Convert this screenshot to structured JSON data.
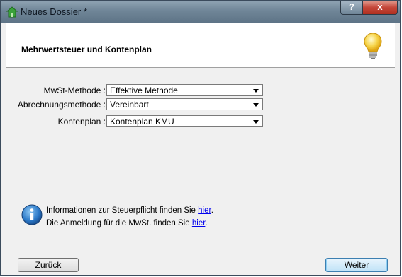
{
  "window": {
    "title": "Neues Dossier *",
    "help_label": "?",
    "close_label": "x"
  },
  "header": {
    "title": "Mehrwertsteuer und Kontenplan"
  },
  "form": {
    "fields": [
      {
        "label": "MwSt-Methode :",
        "value": "Effektive Methode"
      },
      {
        "label": "Abrechnungsmethode :",
        "value": "Vereinbart"
      },
      {
        "label": "Kontenplan :",
        "value": "Kontenplan KMU"
      }
    ]
  },
  "info": {
    "line1_text": "Informationen zur Steuerpflicht finden Sie ",
    "line1_link": "hier",
    "line1_end": ".",
    "line2_text": "Die Anmeldung für die MwSt. finden Sie ",
    "line2_link": "hier",
    "line2_end": "."
  },
  "buttons": {
    "back_first": "Z",
    "back_rest": "urück",
    "next_first": "W",
    "next_rest": "eiter"
  },
  "icons": {
    "title": "dossier-icon",
    "header": "lightbulb-icon",
    "info": "info-icon"
  },
  "colors": {
    "link": "#0000ee",
    "title_bar": "#6f8597",
    "close": "#c4473a"
  }
}
